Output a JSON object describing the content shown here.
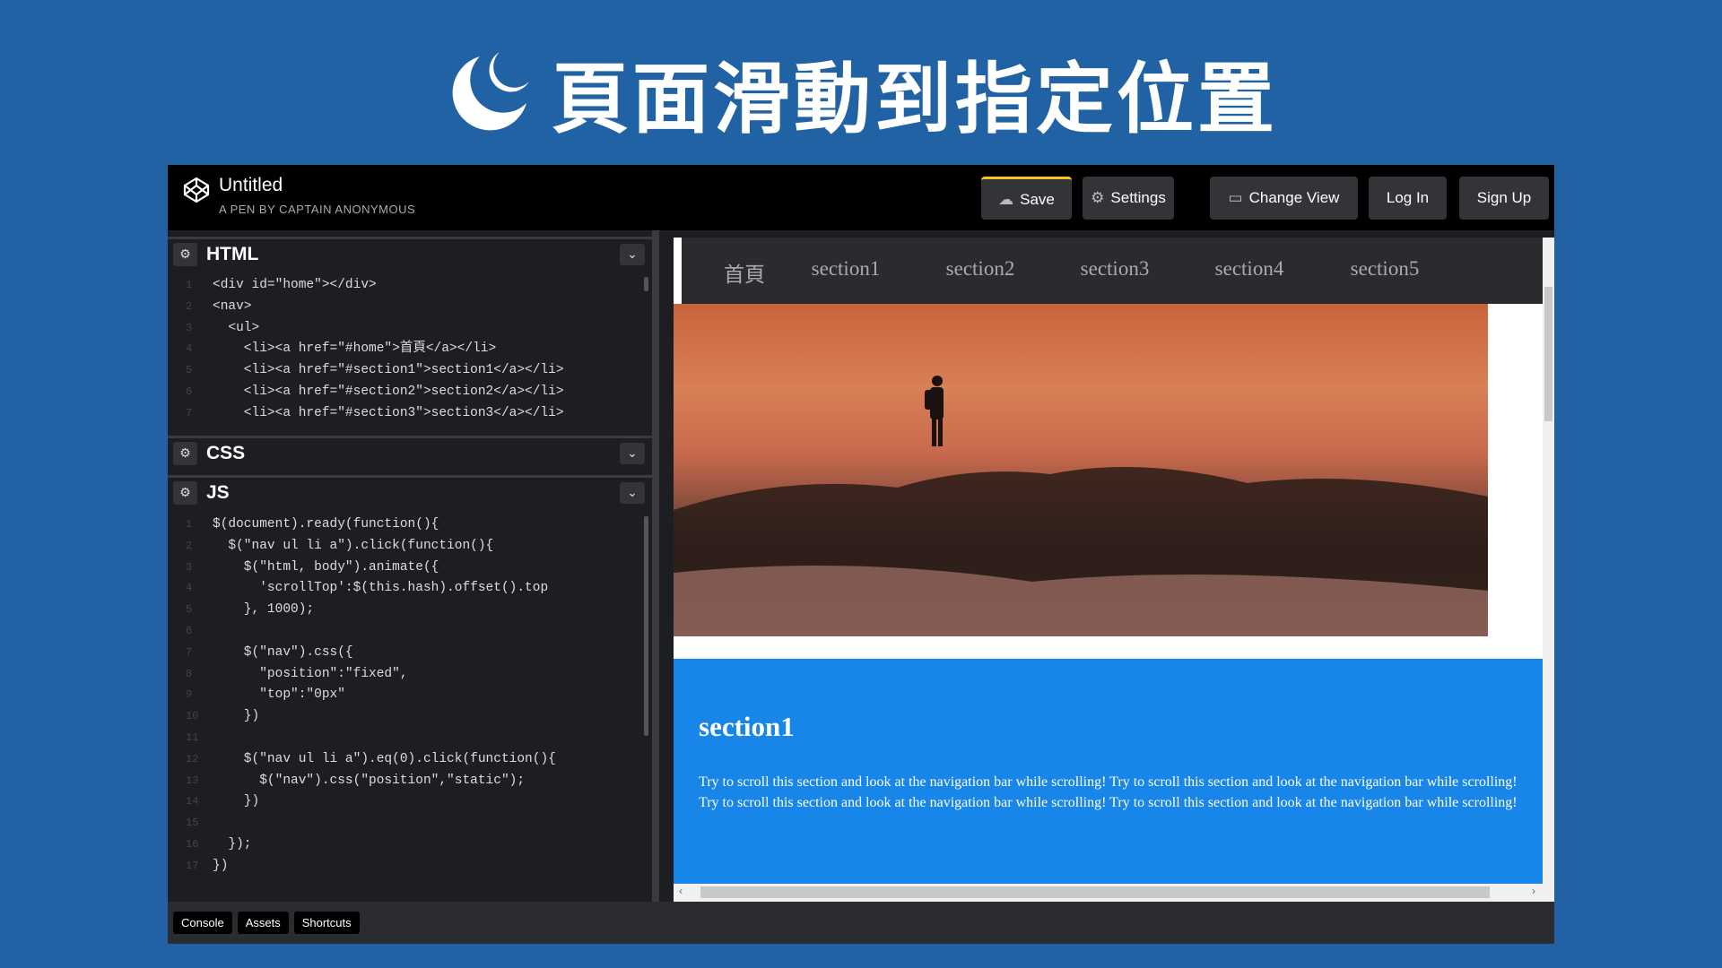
{
  "slide_title": "頁面滑動到指定位置",
  "header": {
    "pen_title": "Untitled",
    "pen_subtitle": "A PEN BY CAPTAIN ANONYMOUS",
    "buttons": {
      "save": "Save",
      "settings": "Settings",
      "change_view": "Change View",
      "login": "Log In",
      "signup": "Sign Up"
    },
    "save_accent": "#f5c518"
  },
  "panels": {
    "html": {
      "label": "HTML",
      "lines": [
        "<div id=\"home\"></div>",
        "<nav>",
        "  <ul>",
        "    <li><a href=\"#home\">首頁</a></li>",
        "    <li><a href=\"#section1\">section1</a></li>",
        "    <li><a href=\"#section2\">section2</a></li>",
        "    <li><a href=\"#section3\">section3</a></li>"
      ]
    },
    "css": {
      "label": "CSS"
    },
    "js": {
      "label": "JS",
      "lines": [
        "$(document).ready(function(){",
        "  $(\"nav ul li a\").click(function(){",
        "    $(\"html, body\").animate({",
        "      'scrollTop':$(this.hash).offset().top",
        "    }, 1000);",
        "",
        "    $(\"nav\").css({",
        "      \"position\":\"fixed\",",
        "      \"top\":\"0px\"",
        "    })",
        "",
        "    $(\"nav ul li a\").eq(0).click(function(){",
        "      $(\"nav\").css(\"position\",\"static\");",
        "    })",
        "",
        "  });",
        "})"
      ]
    }
  },
  "bottom_bar": [
    "Console",
    "Assets",
    "Shortcuts"
  ],
  "preview": {
    "nav": [
      "首頁",
      "section1",
      "section2",
      "section3",
      "section4",
      "section5"
    ],
    "section_title": "section1",
    "section_text": "Try to scroll this section and look at the navigation bar while scrolling! Try to scroll this section and look at the navigation bar while scrolling! Try to scroll this section and look at the navigation bar while scrolling! Try to scroll this section and look at the navigation bar while scrolling!",
    "section_color": "#1886e8"
  }
}
